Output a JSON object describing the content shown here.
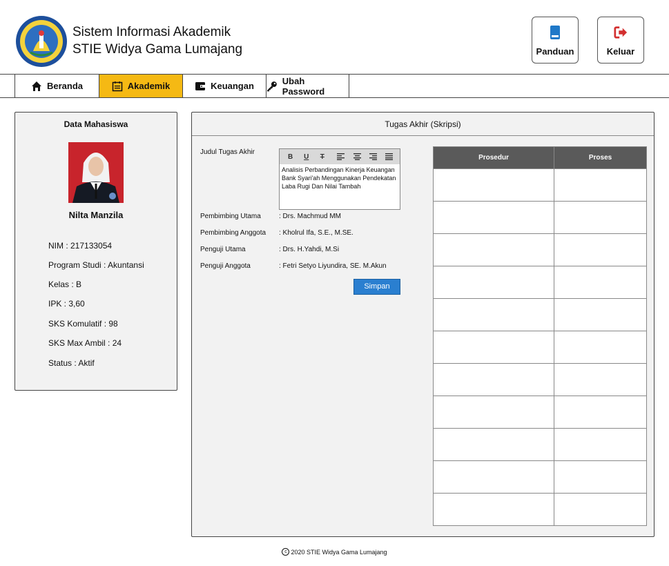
{
  "header": {
    "title_line1": "Sistem Informasi Akademik",
    "title_line2": "STIE Widya Gama Lumajang",
    "logo_alt": "STIE Widya Gama Lumajang seal",
    "panduan_label": "Panduan",
    "keluar_label": "Keluar"
  },
  "nav": {
    "items": [
      {
        "label": "Beranda",
        "icon": "home-icon"
      },
      {
        "label": "Akademik",
        "icon": "calendar-icon",
        "active": true
      },
      {
        "label": "Keuangan",
        "icon": "wallet-icon"
      },
      {
        "label": "Ubah Password",
        "icon": "key-icon"
      }
    ]
  },
  "student": {
    "panel_title": "Data Mahasiswa",
    "name": "Nilta Manzila",
    "nim": "NIM : 217133054",
    "program": "Program Studi : Akuntansi",
    "kelas": "Kelas : B",
    "ipk": "IPK : 3,60",
    "sks_komulatif": "SKS Komulatif : 98",
    "sks_max": "SKS Max Ambil : 24",
    "status": "Status : Aktif"
  },
  "thesis": {
    "panel_title": "Tugas Akhir (Skripsi)",
    "judul_label": "Judul Tugas Akhir",
    "judul_value": "Analisis Perbandingan Kinerja Keuangan Bank Syari'ah Menggunakan Pendekatan Laba Rugi Dan Nilai Tambah",
    "toolbar": [
      "B",
      "U",
      "T"
    ],
    "pembimbing_utama_label": "Pembimbing Utama",
    "pembimbing_utama_value": ": Drs. Machmud MM",
    "pembimbing_anggota_label": "Pembimbing Anggota",
    "pembimbing_anggota_value": ": Kholrul Ifa, S.E., M.SE.",
    "penguji_utama_label": "Penguji Utama",
    "penguji_utama_value": ": Drs. H.Yahdi, M.Si",
    "penguji_anggota_label": "Penguji Anggota",
    "penguji_anggota_value": ": Fetri Setyo Liyundira, SE. M.Akun",
    "save_label": "Simpan",
    "table_headers": [
      "Prosedur",
      "Proses"
    ]
  },
  "footer": {
    "text": "2020 STIE Widya Gama Lumajang"
  },
  "colors": {
    "active_tab": "#f5b914",
    "save_button": "#2a7fd0",
    "table_header": "#5a5a5a",
    "panduan_icon": "#1f78c8",
    "keluar_icon": "#d32f2f"
  }
}
